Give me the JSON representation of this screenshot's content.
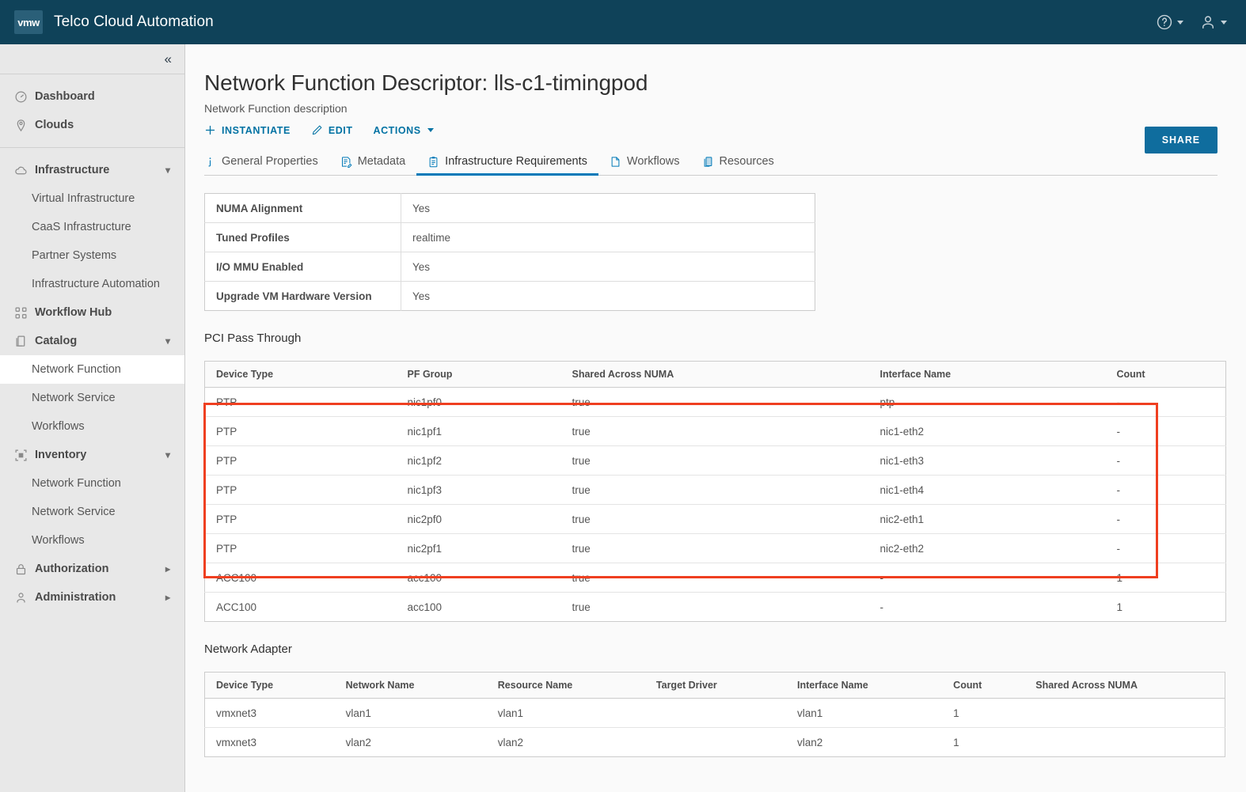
{
  "app": {
    "logo_text": "vmw",
    "title": "Telco Cloud Automation",
    "help_icon": "help-circle-icon",
    "user_icon": "user-icon"
  },
  "sidebar": {
    "collapse_icon": "chevron-double-left-icon",
    "groups": [
      {
        "items": [
          {
            "label": "Dashboard",
            "icon": "dashboard-icon",
            "level": "top"
          },
          {
            "label": "Clouds",
            "icon": "location-pin-icon",
            "level": "top"
          }
        ]
      },
      {
        "items": [
          {
            "label": "Infrastructure",
            "icon": "cloud-icon",
            "level": "top",
            "arrow": "chevron-down"
          },
          {
            "label": "Virtual Infrastructure",
            "level": "child"
          },
          {
            "label": "CaaS Infrastructure",
            "level": "child"
          },
          {
            "label": "Partner Systems",
            "level": "child"
          },
          {
            "label": "Infrastructure Automation",
            "level": "child"
          },
          {
            "label": "Workflow Hub",
            "icon": "workflow-hub-icon",
            "level": "top"
          },
          {
            "label": "Catalog",
            "icon": "catalog-icon",
            "level": "top",
            "arrow": "chevron-down"
          },
          {
            "label": "Network Function",
            "level": "child",
            "selected": true
          },
          {
            "label": "Network Service",
            "level": "child"
          },
          {
            "label": "Workflows",
            "level": "child"
          },
          {
            "label": "Inventory",
            "icon": "inventory-icon",
            "level": "top",
            "arrow": "chevron-down"
          },
          {
            "label": "Network Function",
            "level": "child"
          },
          {
            "label": "Network Service",
            "level": "child"
          },
          {
            "label": "Workflows",
            "level": "child"
          },
          {
            "label": "Authorization",
            "icon": "lock-icon",
            "level": "top",
            "arrow": "chevron-right"
          },
          {
            "label": "Administration",
            "icon": "person-icon",
            "level": "top",
            "arrow": "chevron-right"
          }
        ]
      }
    ]
  },
  "page": {
    "title": "Network Function Descriptor: lls-c1-timingpod",
    "subtitle": "Network Function description",
    "share_label": "Share",
    "actions": [
      {
        "label": "Instantiate",
        "icon": "plus-icon"
      },
      {
        "label": "Edit",
        "icon": "pencil-icon"
      },
      {
        "label": "Actions",
        "icon": "",
        "caret": true
      }
    ]
  },
  "tabs": [
    {
      "label": "General Properties",
      "icon": "info-icon",
      "active": false
    },
    {
      "label": "Metadata",
      "icon": "metadata-icon",
      "active": false
    },
    {
      "label": "Infrastructure Requirements",
      "icon": "clipboard-icon",
      "active": true
    },
    {
      "label": "Workflows",
      "icon": "workflow-icon",
      "active": false
    },
    {
      "label": "Resources",
      "icon": "resources-icon",
      "active": false
    }
  ],
  "infrastructure": {
    "properties": [
      {
        "key": "NUMA Alignment",
        "value": "Yes"
      },
      {
        "key": "Tuned Profiles",
        "value": "realtime"
      },
      {
        "key": "I/O MMU Enabled",
        "value": "Yes"
      },
      {
        "key": "Upgrade VM Hardware Version",
        "value": "Yes"
      }
    ],
    "pci_pass_through": {
      "title": "PCI Pass Through",
      "columns": [
        "Device Type",
        "PF Group",
        "Shared Across NUMA",
        "Interface Name",
        "Count"
      ],
      "rows": [
        [
          "PTP",
          "nic1pf0",
          "true",
          "ptp",
          "-"
        ],
        [
          "PTP",
          "nic1pf1",
          "true",
          "nic1-eth2",
          "-"
        ],
        [
          "PTP",
          "nic1pf2",
          "true",
          "nic1-eth3",
          "-"
        ],
        [
          "PTP",
          "nic1pf3",
          "true",
          "nic1-eth4",
          "-"
        ],
        [
          "PTP",
          "nic2pf0",
          "true",
          "nic2-eth1",
          "-"
        ],
        [
          "PTP",
          "nic2pf1",
          "true",
          "nic2-eth2",
          "-"
        ],
        [
          "ACC100",
          "acc100",
          "true",
          "-",
          "1"
        ],
        [
          "ACC100",
          "acc100",
          "true",
          "-",
          "1"
        ]
      ],
      "highlight_color": "#ef3f20"
    },
    "network_adapter": {
      "title": "Network Adapter",
      "columns": [
        "Device Type",
        "Network Name",
        "Resource Name",
        "Target Driver",
        "Interface Name",
        "Count",
        "Shared Across NUMA"
      ],
      "rows": [
        [
          "vmxnet3",
          "vlan1",
          "vlan1",
          "",
          "vlan1",
          "1",
          ""
        ],
        [
          "vmxnet3",
          "vlan2",
          "vlan2",
          "",
          "vlan2",
          "1",
          ""
        ]
      ]
    }
  },
  "colors": {
    "header_bg": "#0f4259",
    "accent_link": "#0072a3",
    "accent_tab": "#0079b8",
    "share_bg": "#0f6d9e",
    "highlight": "#ef3f20"
  }
}
